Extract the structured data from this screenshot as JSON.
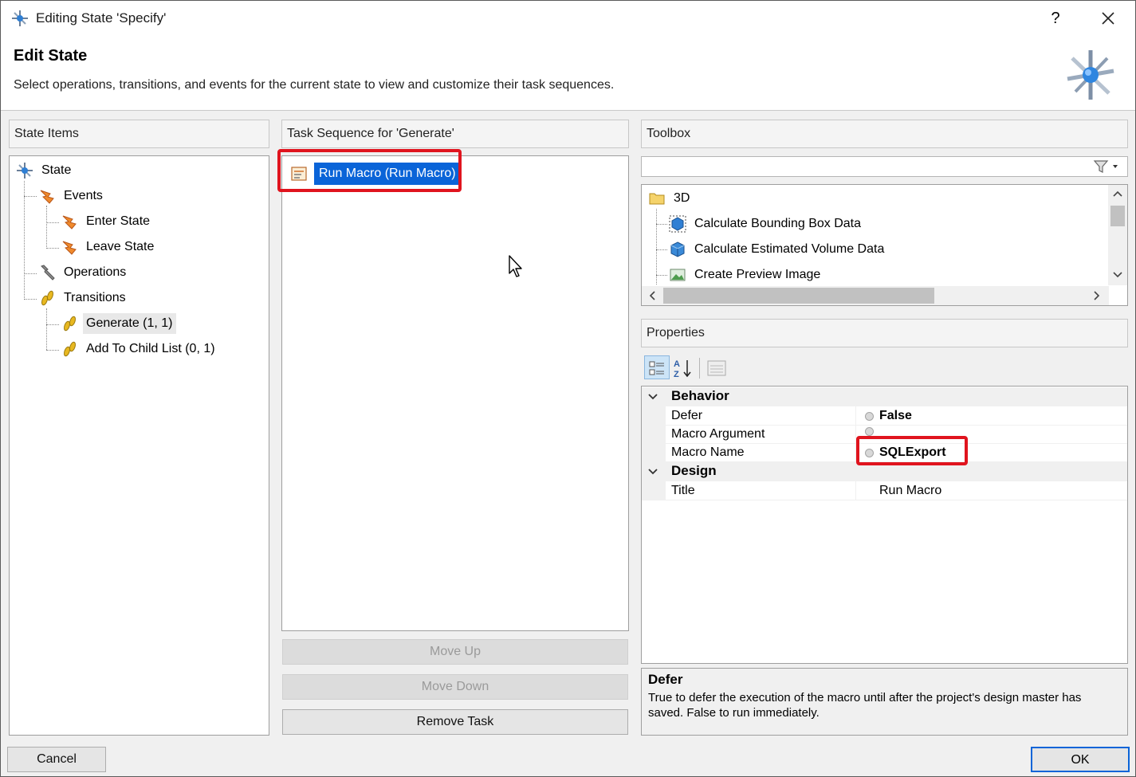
{
  "window": {
    "title": "Editing State 'Specify'",
    "help_label": "?",
    "close_icon": "close-icon"
  },
  "header": {
    "title": "Edit State",
    "description": "Select operations, transitions, and events for the current state to view and customize their task sequences."
  },
  "state_items": {
    "heading": "State Items",
    "tree": {
      "root": "State",
      "events": "Events",
      "enter_state": "Enter State",
      "leave_state": "Leave State",
      "operations": "Operations",
      "transitions": "Transitions",
      "generate": "Generate (1, 1)",
      "add_to_child_list": "Add To Child List (0, 1)"
    }
  },
  "task_sequence": {
    "heading": "Task Sequence for 'Generate'",
    "tasks": [
      "Run Macro (Run Macro)"
    ],
    "move_up": "Move Up",
    "move_down": "Move Down",
    "remove_task": "Remove Task"
  },
  "toolbox": {
    "heading": "Toolbox",
    "search_value": "",
    "folder": "3D",
    "items": [
      "Calculate Bounding Box Data",
      "Calculate Estimated Volume Data",
      "Create Preview Image"
    ]
  },
  "properties": {
    "heading": "Properties",
    "categories": [
      {
        "name": "Behavior",
        "rows": [
          {
            "name": "Defer",
            "value": "False"
          },
          {
            "name": "Macro Argument",
            "value": ""
          },
          {
            "name": "Macro Name",
            "value": "SQLExport"
          }
        ]
      },
      {
        "name": "Design",
        "rows": [
          {
            "name": "Title",
            "value": "Run Macro"
          }
        ]
      }
    ],
    "description_title": "Defer",
    "description_text": "True to defer the execution of the macro until after the project's design master has saved. False to run immediately."
  },
  "footer": {
    "cancel": "Cancel",
    "ok": "OK"
  },
  "colors": {
    "selection": "#0a64d8",
    "highlight_box": "#e0141e"
  }
}
